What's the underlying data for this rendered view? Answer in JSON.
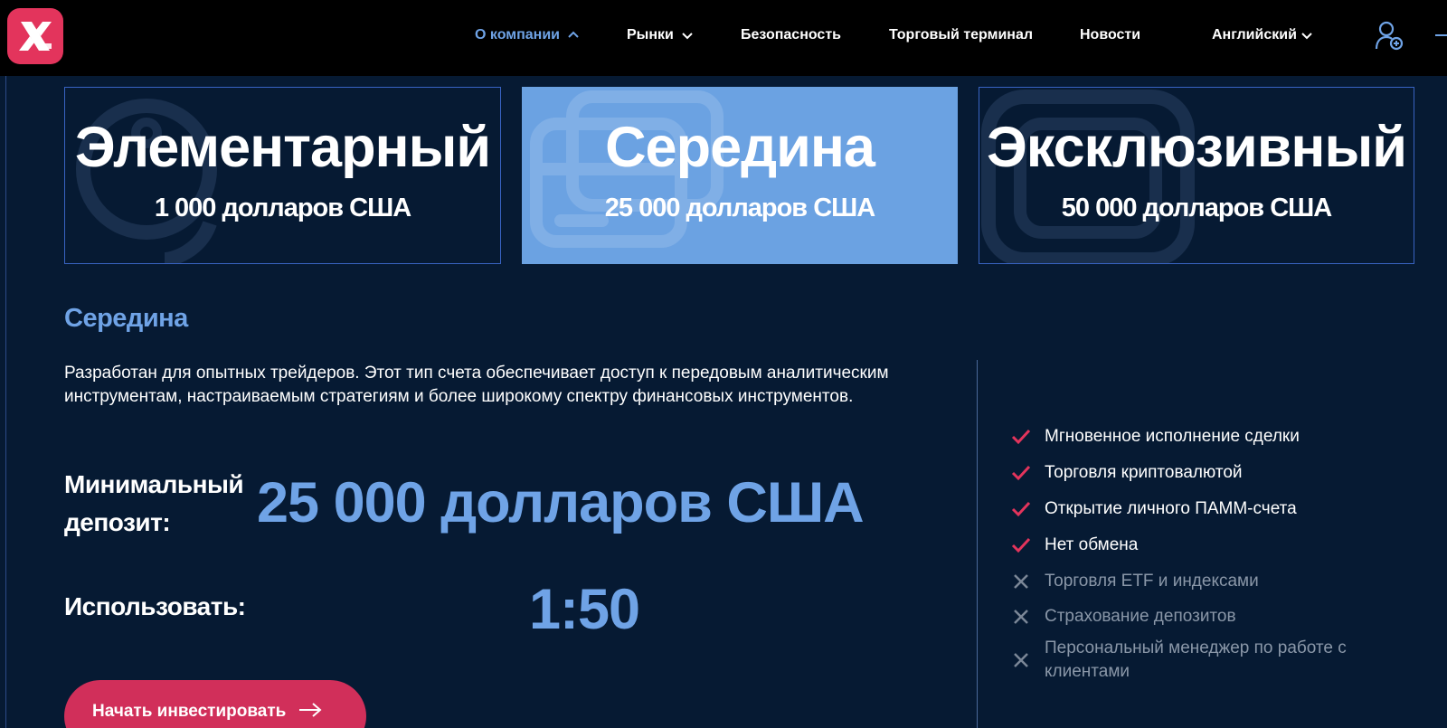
{
  "header": {
    "nav": [
      {
        "label": "О компании",
        "active": true
      },
      {
        "label": "Рынки",
        "active": false
      },
      {
        "label": "Безопасность",
        "active": false
      },
      {
        "label": "Торговый терминал",
        "active": false
      },
      {
        "label": "Новости",
        "active": false
      }
    ],
    "language": "Английский",
    "icons": {
      "logo": "x-logo-icon",
      "user": "user-add-icon",
      "menu": "menu-icon"
    }
  },
  "plans": [
    {
      "title": "Элементарный",
      "price": "1 000 долларов США",
      "selected": false,
      "icon": "coin-icon"
    },
    {
      "title": "Середина",
      "price": "25 000 долларов США",
      "selected": true,
      "icon": "wallet-icon"
    },
    {
      "title": "Эксклюзивный",
      "price": "50 000 долларов США",
      "selected": false,
      "icon": "safe-icon"
    }
  ],
  "detail": {
    "title": "Середина",
    "description": "Разработан для опытных трейдеров. Этот тип счета обеспечивает доступ к передовым аналитическим инструментам, настраиваемым стратегиям и более широкому спектру финансовых инструментов.",
    "min_deposit_label": "Минимальный депозит:",
    "min_deposit_value": "25 000 долларов США",
    "leverage_label": "Использовать:",
    "leverage_value": "1:50",
    "cta_label": "Начать инвестировать"
  },
  "features": [
    {
      "label": "Мгновенное исполнение сделки",
      "included": true
    },
    {
      "label": "Торговля криптовалютой",
      "included": true
    },
    {
      "label": "Открытие личного ПАММ-счета",
      "included": true
    },
    {
      "label": "Нет обмена",
      "included": true
    },
    {
      "label": "Торговля ETF и индексами",
      "included": false
    },
    {
      "label": "Страхование депозитов",
      "included": false
    },
    {
      "label": "Персональный менеджер по работе с клиентами",
      "included": false
    }
  ],
  "colors": {
    "background": "#061a33",
    "accent_blue": "#6fa3e6",
    "selected_card": "#6ba2e2",
    "cta": "#d12f5a",
    "check": "#e3345c",
    "disabled": "#8a97a8"
  }
}
